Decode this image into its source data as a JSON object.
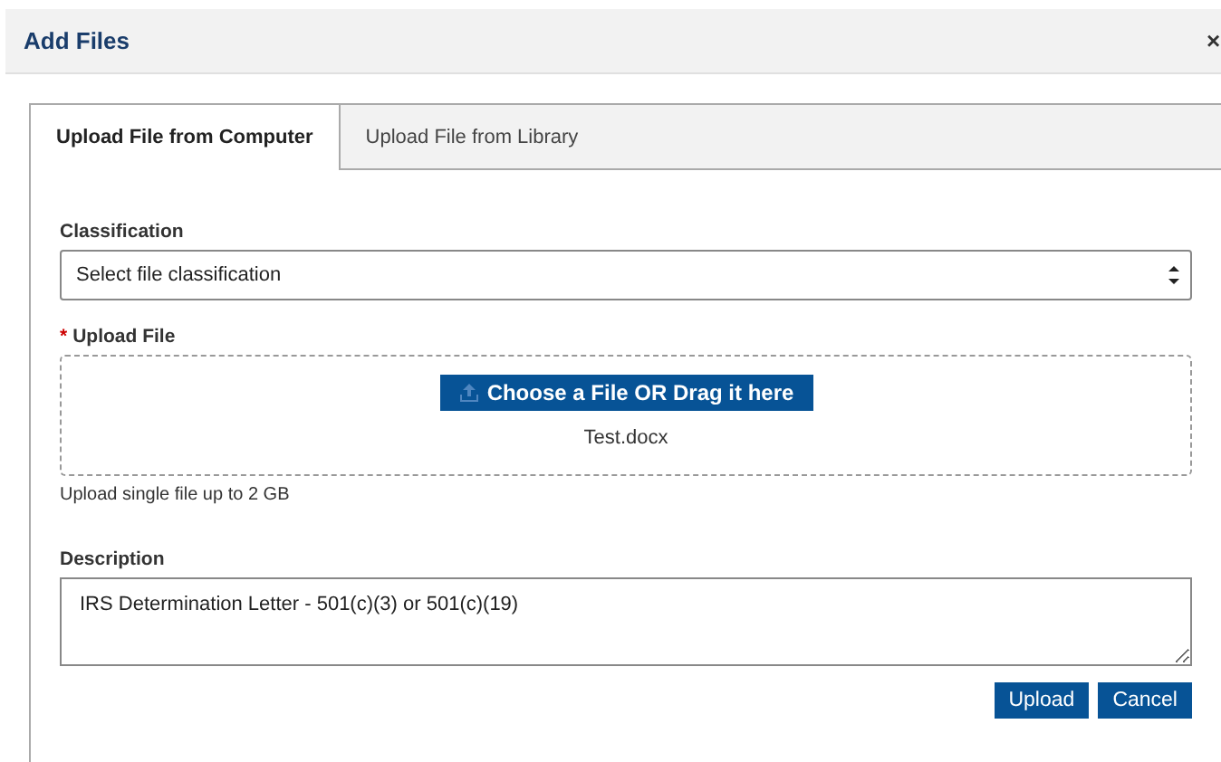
{
  "dialog": {
    "title": "Add Files",
    "close": "×"
  },
  "tabs": [
    {
      "label": "Upload File from Computer",
      "selected": true
    },
    {
      "label": "Upload File from Library",
      "selected": false
    }
  ],
  "classification": {
    "label": "Classification",
    "value": "Select file classification"
  },
  "upload": {
    "label": "Upload File",
    "required": true,
    "required_mark": "*",
    "button": "Choose a File OR Drag it here",
    "file": "Test.docx",
    "hint": "Upload single file up to 2 GB"
  },
  "description": {
    "label": "Description",
    "value": "IRS Determination Letter - 501(c)(3) or 501(c)(19)"
  },
  "buttons": [
    "Upload",
    "Cancel"
  ]
}
